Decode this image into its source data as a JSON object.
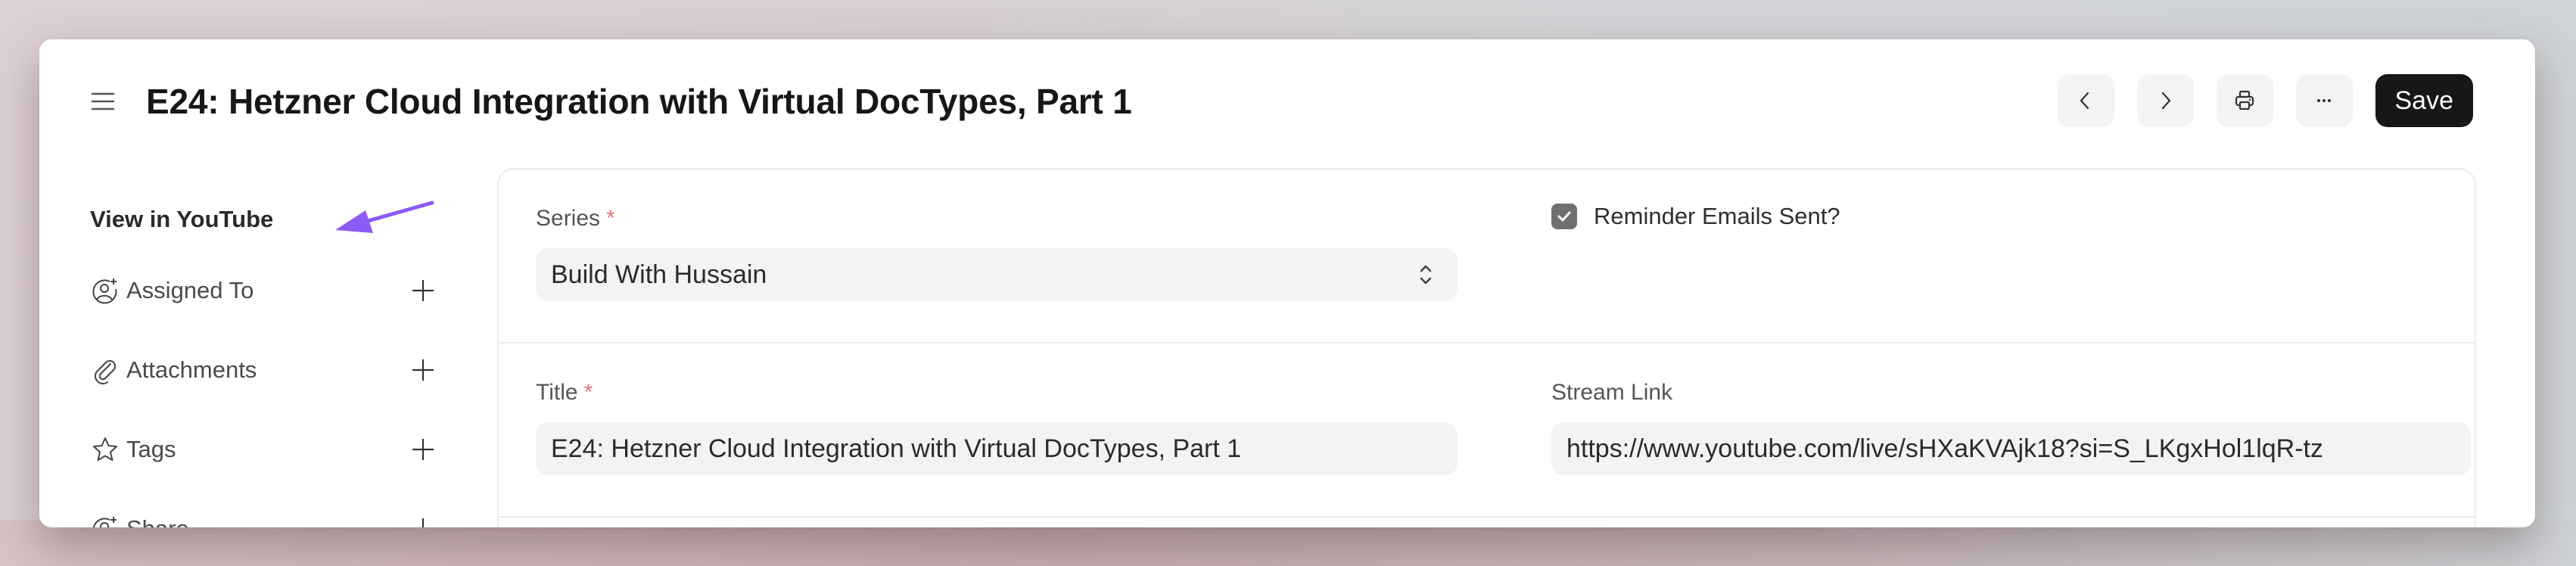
{
  "header": {
    "title": "E24: Hetzner Cloud Integration with Virtual DocTypes, Part 1",
    "menu_icon": "hamburger-icon",
    "toolbar": {
      "prev_icon": "chevron-left-icon",
      "next_icon": "chevron-right-icon",
      "print_icon": "printer-icon",
      "more_icon": "ellipsis-icon",
      "save_label": "Save"
    }
  },
  "sidebar": {
    "youtube_link": "View in YouTube",
    "annotation_color": "#8b5cf6",
    "items": [
      {
        "label": "Assigned To",
        "icon": "user-add-icon"
      },
      {
        "label": "Attachments",
        "icon": "paperclip-icon"
      },
      {
        "label": "Tags",
        "icon": "star-icon"
      },
      {
        "label": "Share",
        "icon": "user-add-icon"
      }
    ]
  },
  "form": {
    "series": {
      "label": "Series",
      "required_mark": "*",
      "value": "Build With Hussain"
    },
    "reminder": {
      "label": "Reminder Emails Sent?",
      "checked": true
    },
    "title": {
      "label": "Title",
      "required_mark": "*",
      "value": "E24: Hetzner Cloud Integration with Virtual DocTypes, Part 1"
    },
    "stream_link": {
      "label": "Stream Link",
      "value": "https://www.youtube.com/live/sHXaKVAjk18?si=S_LKgxHol1lqR-tz"
    }
  }
}
